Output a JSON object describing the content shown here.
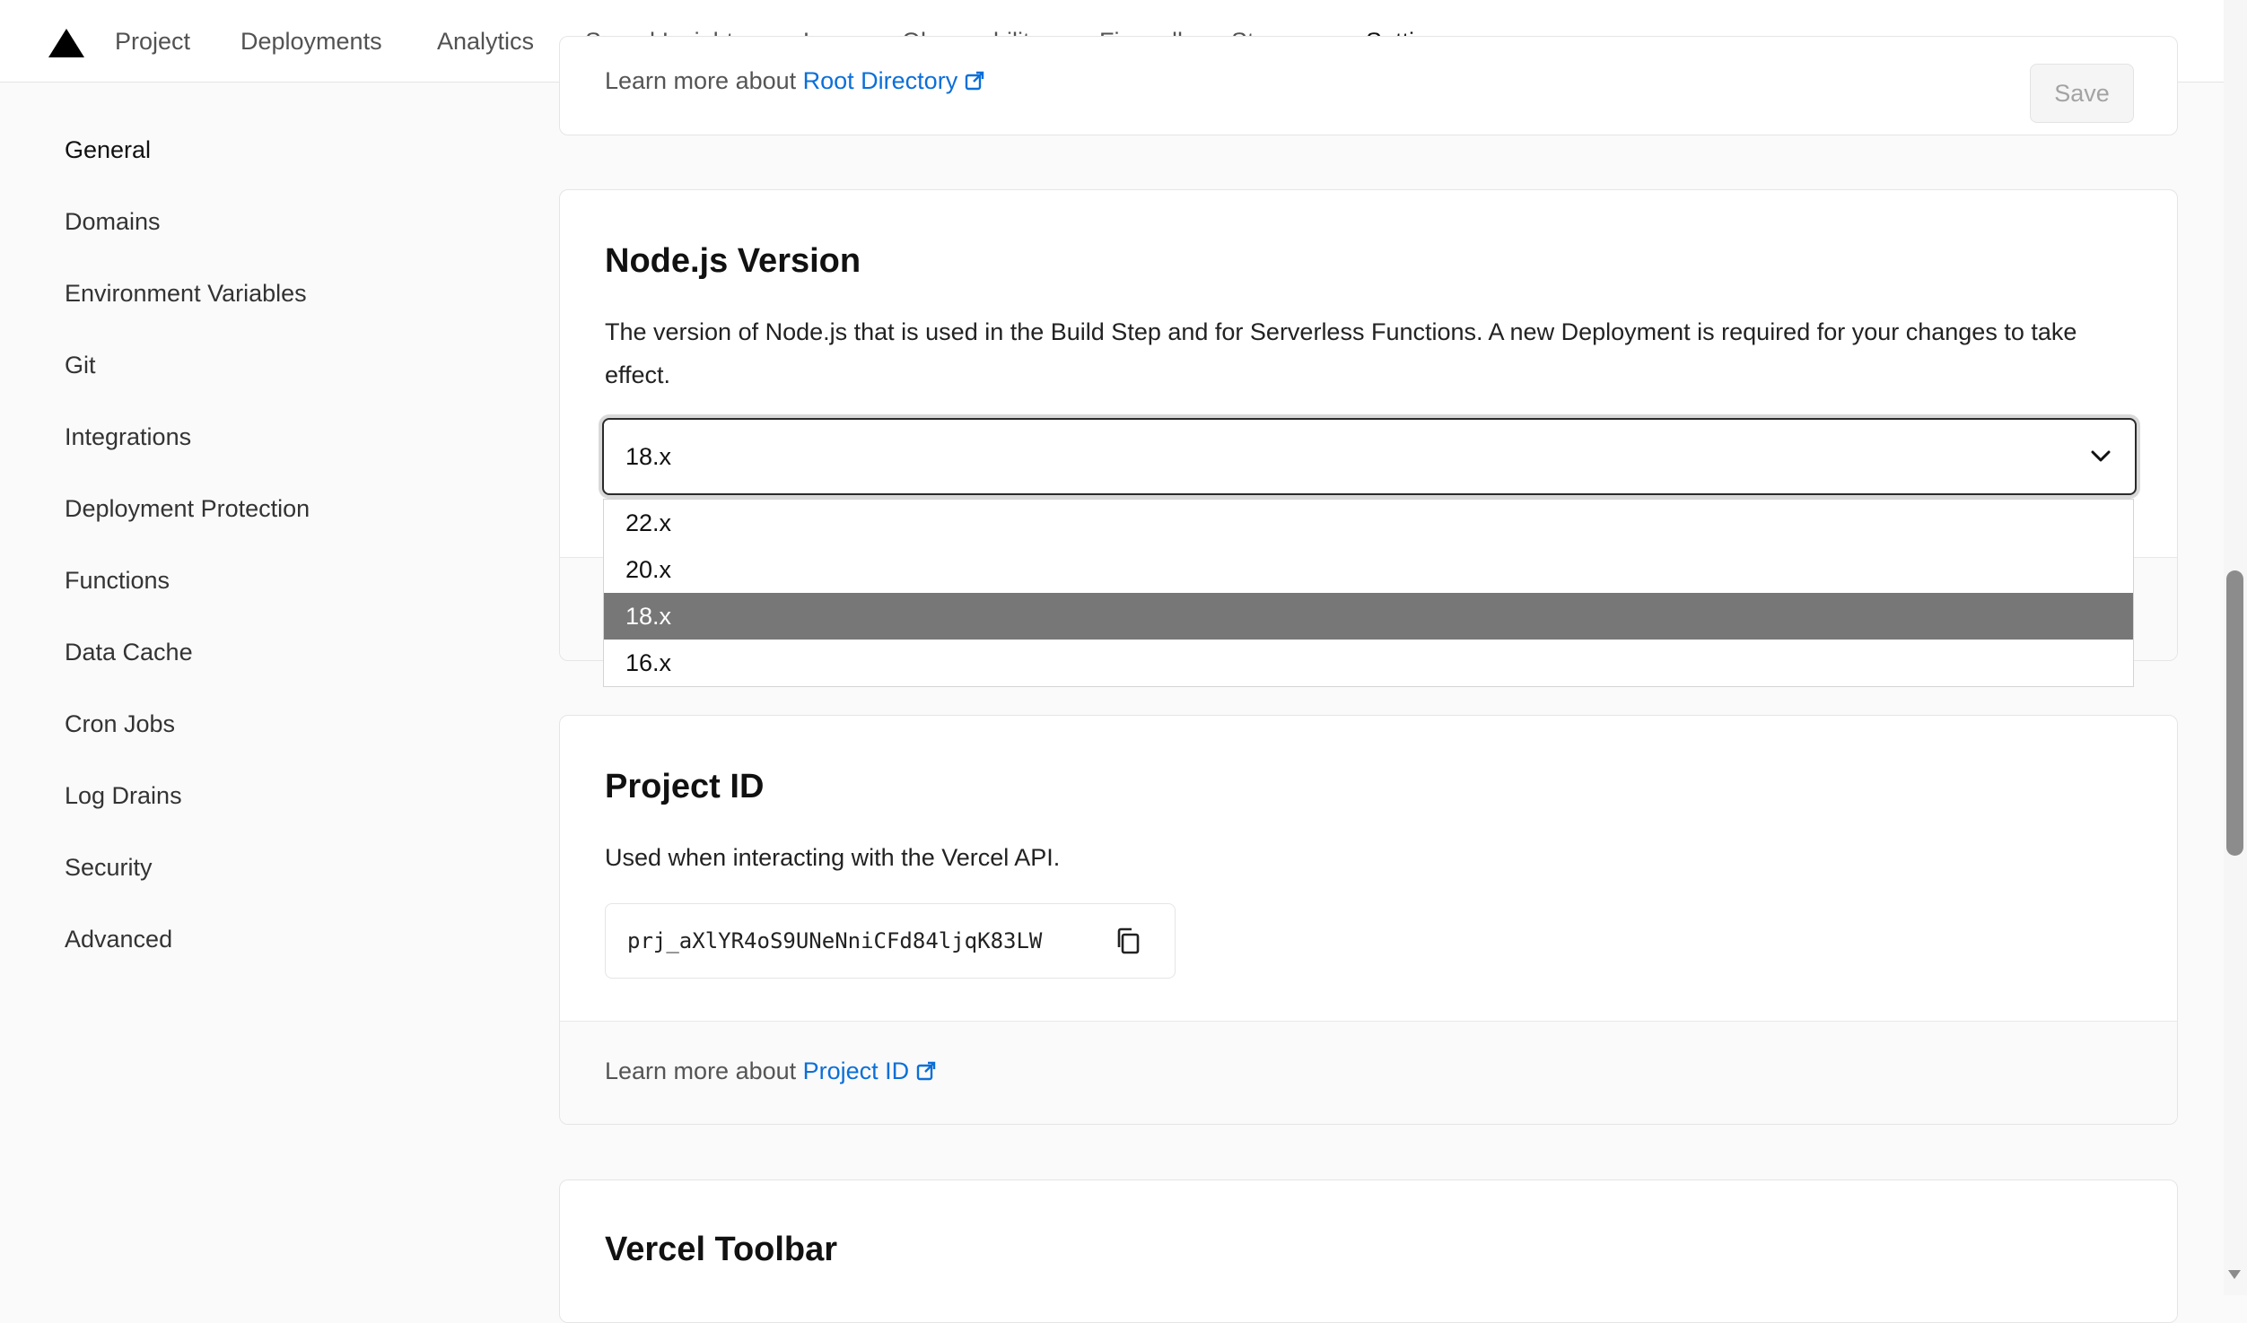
{
  "nav": {
    "tabs": [
      {
        "label": "Project"
      },
      {
        "label": "Deployments"
      },
      {
        "label": "Analytics"
      },
      {
        "label": "Speed Insights"
      },
      {
        "label": "Logs"
      },
      {
        "label": "Observability"
      },
      {
        "label": "Firewall"
      },
      {
        "label": "Storage"
      },
      {
        "label": "Settings",
        "active": true
      }
    ]
  },
  "sidebar": {
    "items": [
      {
        "label": "General"
      },
      {
        "label": "Domains"
      },
      {
        "label": "Environment Variables"
      },
      {
        "label": "Git"
      },
      {
        "label": "Integrations"
      },
      {
        "label": "Deployment Protection"
      },
      {
        "label": "Functions"
      },
      {
        "label": "Data Cache"
      },
      {
        "label": "Cron Jobs"
      },
      {
        "label": "Log Drains"
      },
      {
        "label": "Security"
      },
      {
        "label": "Advanced"
      }
    ]
  },
  "root_directory_card": {
    "learn_prefix": "Learn more about ",
    "learn_link": "Root Directory",
    "save_label": "Save"
  },
  "node_card": {
    "title": "Node.js Version",
    "description": "The version of Node.js that is used in the Build Step and for Serverless Functions. A new Deployment is required for your changes to take effect.",
    "select_value": "18.x",
    "options": [
      "22.x",
      "20.x",
      "18.x",
      "16.x"
    ],
    "selected_option": "18.x"
  },
  "project_id_card": {
    "title": "Project ID",
    "description": "Used when interacting with the Vercel API.",
    "id_value": "prj_aXlYR4oS9UNeNniCFd84ljqK83LW",
    "learn_prefix": "Learn more about ",
    "learn_link": "Project ID"
  },
  "toolbar_card": {
    "title": "Vercel Toolbar"
  },
  "icons": {
    "logo": "vercel-triangle-icon",
    "external": "external-link-icon",
    "copy": "copy-icon",
    "chevron": "chevron-down-icon"
  },
  "colors": {
    "link": "#0b6fd8",
    "selected_option_bg": "#777777",
    "active_tab_underline": "#111111"
  }
}
